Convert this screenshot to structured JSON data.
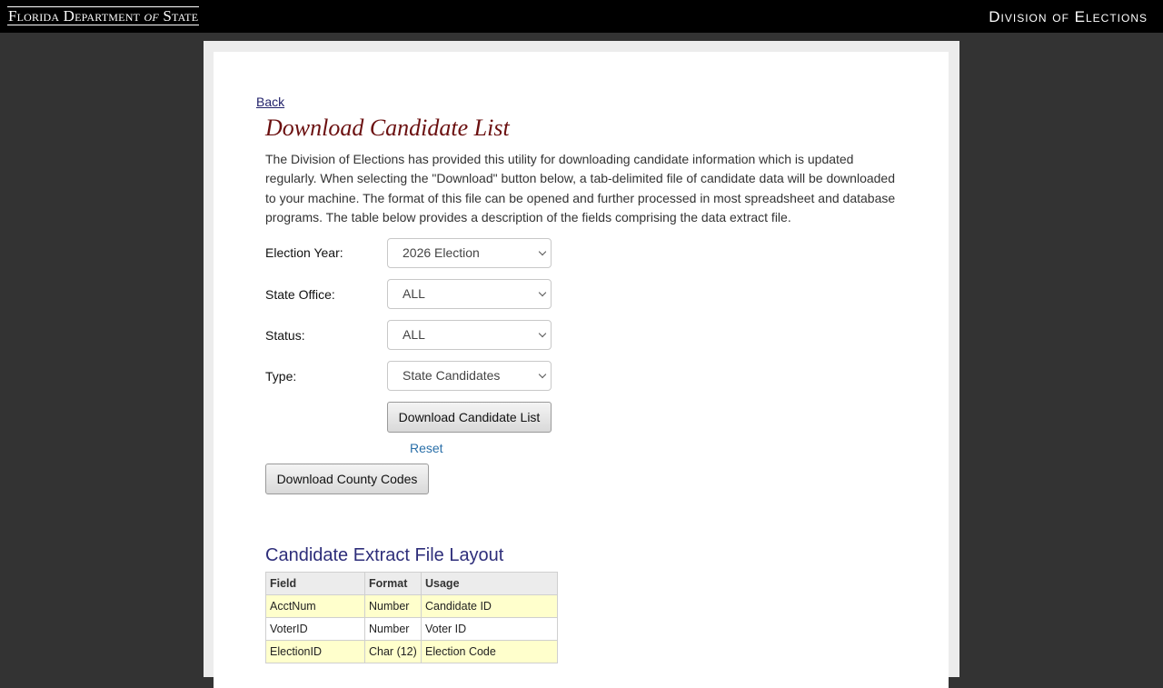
{
  "header": {
    "logo_part1": "Florida Department",
    "logo_of": "of",
    "logo_part2": "State",
    "division": "Division of Elections"
  },
  "page": {
    "back_link": "Back",
    "title": "Download Candidate List",
    "intro": "The Division of Elections has provided this utility for downloading candidate information which is updated regularly. When selecting the \"Download\" button below, a tab-delimited file of candidate data will be downloaded to your machine. The format of this file can be opened and further processed in most spreadsheet and database programs. The table below provides a description of the fields comprising the data extract file."
  },
  "form": {
    "election_year": {
      "label": "Election Year:",
      "value": "2026 Election"
    },
    "state_office": {
      "label": "State Office:",
      "value": "ALL"
    },
    "status": {
      "label": "Status:",
      "value": "ALL"
    },
    "type": {
      "label": "Type:",
      "value": "State Candidates"
    },
    "download_button": "Download Candidate List",
    "reset_link": "Reset",
    "county_codes_button": "Download County Codes"
  },
  "layout_table": {
    "title": "Candidate Extract File Layout",
    "headers": [
      "Field",
      "Format",
      "Usage"
    ],
    "rows": [
      [
        "AcctNum",
        "Number",
        "Candidate ID"
      ],
      [
        "VoterID",
        "Number",
        "Voter ID"
      ],
      [
        "ElectionID",
        "Char (12)",
        "Election Code"
      ]
    ]
  },
  "colors": {
    "title": "#6b1010",
    "table_title": "#2e2e7a",
    "highlight_row": "#ffffcc",
    "link": "#2a6fa8"
  }
}
